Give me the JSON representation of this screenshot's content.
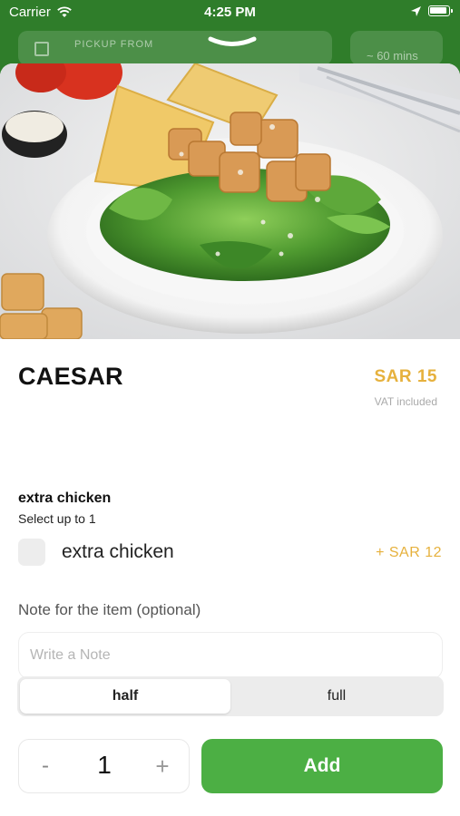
{
  "status_bar": {
    "carrier": "Carrier",
    "time": "4:25 PM"
  },
  "background": {
    "pickup_label": "PICKUP FROM",
    "eta": "~ 60 mins"
  },
  "item": {
    "name": "CAESAR",
    "price": "SAR 15",
    "vat_note": "VAT included"
  },
  "modifier_group": {
    "title": "extra chicken",
    "subtitle": "Select up to 1",
    "options": [
      {
        "label": "extra chicken",
        "price": "+ SAR 12",
        "checked": false
      }
    ]
  },
  "note": {
    "label": "Note for the item (optional)",
    "placeholder": "Write a Note",
    "value": ""
  },
  "size_segment": {
    "options": [
      "half",
      "full"
    ],
    "selected": "half"
  },
  "quantity": {
    "minus": "-",
    "value": "1",
    "plus": "+"
  },
  "add_button": {
    "label": "Add"
  },
  "colors": {
    "brand_green": "#4caf44",
    "header_green": "#2f7d2a",
    "price_gold": "#e6b13d"
  }
}
